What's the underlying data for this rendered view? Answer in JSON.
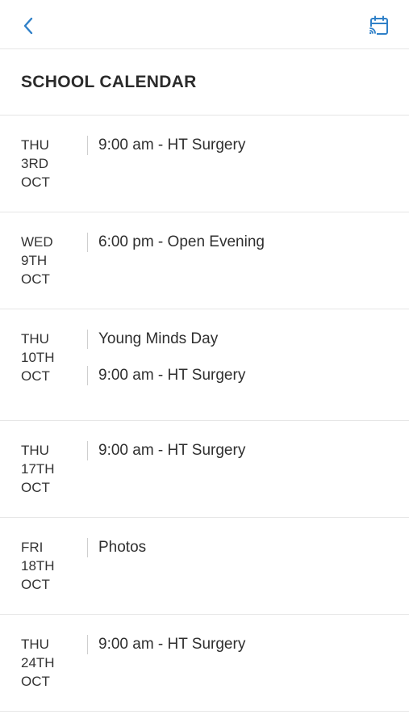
{
  "header": {
    "back_icon": "chevron-left-icon",
    "calendar_icon": "calendar-cast-icon",
    "accent_color": "#2f80c8"
  },
  "page": {
    "title": "SCHOOL CALENDAR"
  },
  "days": [
    {
      "weekday": "THU",
      "day": "3RD",
      "month": "OCT",
      "events": [
        "9:00 am - HT Surgery"
      ]
    },
    {
      "weekday": "WED",
      "day": "9TH",
      "month": "OCT",
      "events": [
        "6:00 pm - Open Evening"
      ]
    },
    {
      "weekday": "THU",
      "day": "10TH",
      "month": "OCT",
      "events": [
        "Young Minds Day",
        "9:00 am - HT Surgery"
      ]
    },
    {
      "weekday": "THU",
      "day": "17TH",
      "month": "OCT",
      "events": [
        "9:00 am - HT Surgery"
      ]
    },
    {
      "weekday": "FRI",
      "day": "18TH",
      "month": "OCT",
      "events": [
        "Photos"
      ]
    },
    {
      "weekday": "THU",
      "day": "24TH",
      "month": "OCT",
      "events": [
        "9:00 am - HT Surgery"
      ]
    }
  ]
}
